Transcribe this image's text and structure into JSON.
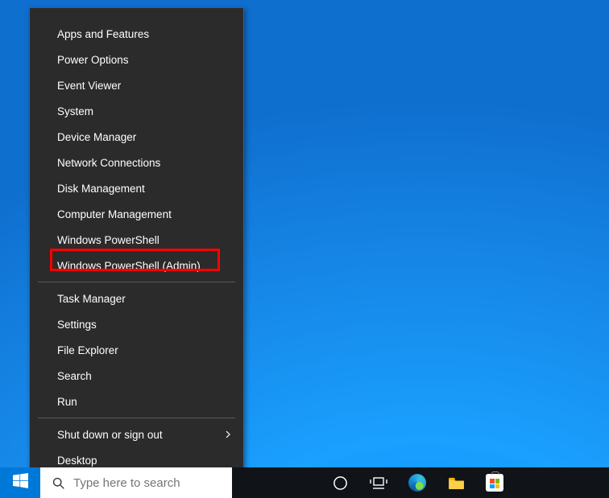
{
  "context_menu": {
    "group1": [
      "Apps and Features",
      "Power Options",
      "Event Viewer",
      "System",
      "Device Manager",
      "Network Connections",
      "Disk Management",
      "Computer Management",
      "Windows PowerShell",
      "Windows PowerShell (Admin)"
    ],
    "group2": [
      "Task Manager",
      "Settings",
      "File Explorer",
      "Search",
      "Run"
    ],
    "group3": [
      "Shut down or sign out",
      "Desktop"
    ],
    "highlighted_index": 9
  },
  "taskbar": {
    "search_placeholder": "Type here to search"
  }
}
